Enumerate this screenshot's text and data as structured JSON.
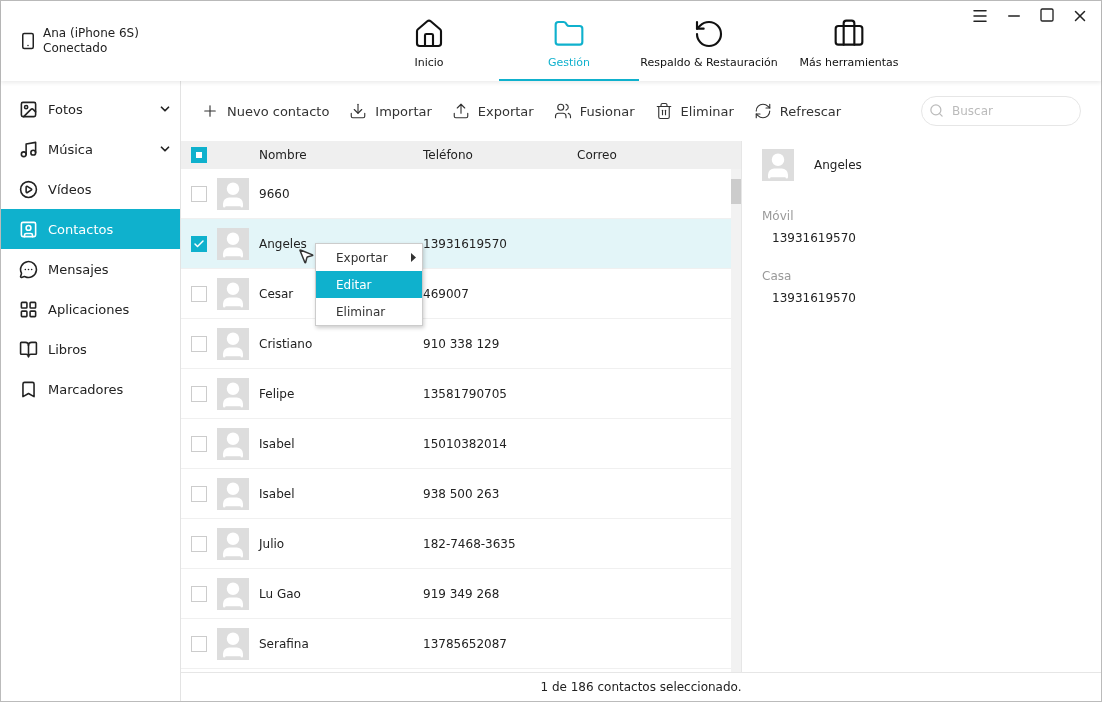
{
  "device": {
    "name": "Ana (iPhone 6S)",
    "status": "Conectado"
  },
  "nav_tabs": [
    {
      "kind": "home",
      "label": "Inicio",
      "selected": false
    },
    {
      "kind": "folder",
      "label": "Gestión",
      "selected": true
    },
    {
      "kind": "restore",
      "label": "Respaldo & Restauración",
      "selected": false
    },
    {
      "kind": "toolbox",
      "label": "Más herramientas",
      "selected": false
    }
  ],
  "sidebar": {
    "items": [
      {
        "kind": "photo",
        "label": "Fotos",
        "expandable": true,
        "selected": false
      },
      {
        "kind": "music",
        "label": "Música",
        "expandable": true,
        "selected": false
      },
      {
        "kind": "video",
        "label": "Vídeos",
        "expandable": false,
        "selected": false
      },
      {
        "kind": "contact",
        "label": "Contactos",
        "expandable": false,
        "selected": true
      },
      {
        "kind": "message",
        "label": "Mensajes",
        "expandable": false,
        "selected": false
      },
      {
        "kind": "apps",
        "label": "Aplicaciones",
        "expandable": false,
        "selected": false
      },
      {
        "kind": "book",
        "label": "Libros",
        "expandable": false,
        "selected": false
      },
      {
        "kind": "bookmark",
        "label": "Marcadores",
        "expandable": false,
        "selected": false
      }
    ]
  },
  "toolbar": [
    {
      "kind": "add",
      "label": "Nuevo contacto"
    },
    {
      "kind": "import",
      "label": "Importar"
    },
    {
      "kind": "export",
      "label": "Exportar"
    },
    {
      "kind": "merge",
      "label": "Fusionar"
    },
    {
      "kind": "delete",
      "label": "Eliminar"
    },
    {
      "kind": "refresh",
      "label": "Refrescar"
    }
  ],
  "search": {
    "placeholder": "Buscar"
  },
  "table": {
    "select_all": {
      "partial": true
    },
    "columns": [
      "Nombre",
      "Teléfono",
      "Correo"
    ],
    "rows": [
      {
        "name": "9660",
        "checked": false,
        "selected": false
      },
      {
        "name": "Angeles",
        "phone": "13931619570",
        "checked": true,
        "selected": true
      },
      {
        "name": "Cesar",
        "phone": "469007",
        "checked": false,
        "selected": false
      },
      {
        "name": "Cristiano",
        "phone": "910 338 129",
        "checked": false,
        "selected": false
      },
      {
        "name": "Felipe",
        "phone": "13581790705",
        "checked": false,
        "selected": false
      },
      {
        "name": "Isabel",
        "phone": "15010382014",
        "checked": false,
        "selected": false
      },
      {
        "name": "Isabel",
        "phone": "938 500 263",
        "checked": false,
        "selected": false
      },
      {
        "name": "Julio",
        "phone": "182-7468-3635",
        "checked": false,
        "selected": false
      },
      {
        "name": "Lu Gao",
        "phone": "919 349 268",
        "checked": false,
        "selected": false
      },
      {
        "name": "Serafina",
        "phone": "13785652087",
        "checked": false,
        "selected": false
      }
    ]
  },
  "context_menu": [
    {
      "label": "Exportar",
      "submenu": true,
      "selected": false
    },
    {
      "label": "Editar",
      "submenu": false,
      "selected": true
    },
    {
      "label": "Eliminar",
      "submenu": false,
      "selected": false
    }
  ],
  "detail": {
    "name": "Angeles",
    "fields": [
      {
        "label": "Móvil",
        "value": "13931619570"
      },
      {
        "label": "Casa",
        "value": "13931619570"
      }
    ]
  },
  "status_bar": "1 de 186 contactos seleccionado."
}
